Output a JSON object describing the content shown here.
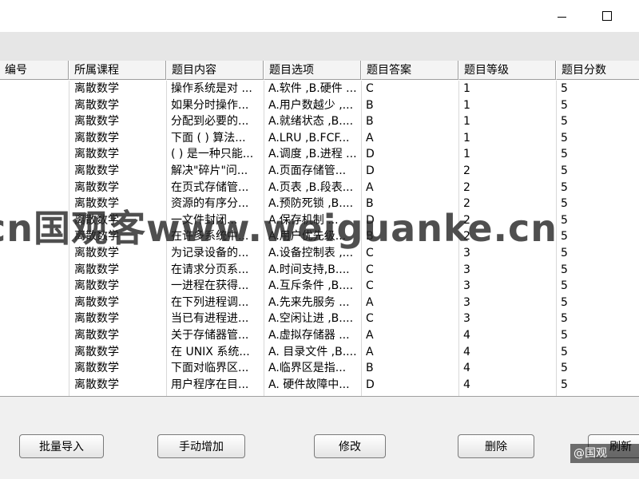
{
  "window": {
    "minimize_glyph": "",
    "maximize_glyph": ""
  },
  "table": {
    "columns": [
      "编号",
      "所属课程",
      "题目内容",
      "题目选项",
      "题目答案",
      "题目等级",
      "题目分数"
    ],
    "rows": [
      [
        "",
        "离散数学",
        "操作系统是对 ...",
        "A.软件 ,B.硬件 ...",
        "C",
        "1",
        "5"
      ],
      [
        "",
        "离散数学",
        "如果分时操作...",
        "A.用户数越少 ,...",
        "B",
        "1",
        "5"
      ],
      [
        "",
        "离散数学",
        "分配到必要的...",
        "A.就绪状态 ,B....",
        "B",
        "1",
        "5"
      ],
      [
        "",
        "离散数学",
        "下面 ( ) 算法...",
        "A.LRU ,B.FCF...",
        "A",
        "1",
        "5"
      ],
      [
        "",
        "离散数学",
        "( ) 是一种只能...",
        "A.调度 ,B.进程 ...",
        "D",
        "1",
        "5"
      ],
      [
        "",
        "离散数学",
        "解决\"碎片\"问...",
        "A.页面存储管...",
        "D",
        "2",
        "5"
      ],
      [
        "",
        "离散数学",
        "在页式存储管...",
        "A.页表 ,B.段表...",
        "A",
        "2",
        "5"
      ],
      [
        "",
        "离散数学",
        "资源的有序分...",
        "A.预防死锁 ,B....",
        "B",
        "2",
        "5"
      ],
      [
        "",
        "离散数学",
        "一文件封闭...",
        "A.保存机制 ...",
        "D",
        "2",
        "5"
      ],
      [
        "",
        "离散数学",
        "在许多系统中...",
        "A.用户优先级...",
        "B",
        "2",
        "5"
      ],
      [
        "",
        "离散数学",
        "为记录设备的...",
        "A.设备控制表 ,...",
        "C",
        "3",
        "5"
      ],
      [
        "",
        "离散数学",
        "在请求分页系...",
        "A.时间支持,B....",
        "C",
        "3",
        "5"
      ],
      [
        "",
        "离散数学",
        "一进程在获得...",
        "A.互斥条件 ,B....",
        "C",
        "3",
        "5"
      ],
      [
        "",
        "离散数学",
        "在下列进程调...",
        "A.先来先服务 ...",
        "A",
        "3",
        "5"
      ],
      [
        "",
        "离散数学",
        "当已有进程进...",
        "A.空闲让进 ,B....",
        "C",
        "3",
        "5"
      ],
      [
        "",
        "离散数学",
        "关于存储器管...",
        "A.虚拟存储器 ...",
        "A",
        "4",
        "5"
      ],
      [
        "",
        "离散数学",
        "在 UNIX 系统...",
        "A. 目录文件 ,B....",
        "A",
        "4",
        "5"
      ],
      [
        "",
        "离散数学",
        "下面对临界区...",
        "A.临界区是指...",
        "B",
        "4",
        "5"
      ],
      [
        "",
        "离散数学",
        "用户程序在目...",
        "A. 硬件故障中...",
        "D",
        "4",
        "5"
      ]
    ]
  },
  "watermark": "cn国观客www.weiguanke.cn",
  "buttons": {
    "batch_import": "批量导入",
    "manual_add": "手动增加",
    "edit": "修改",
    "delete": "删除",
    "refresh": "刷新"
  },
  "corner_watermark": "@国观"
}
